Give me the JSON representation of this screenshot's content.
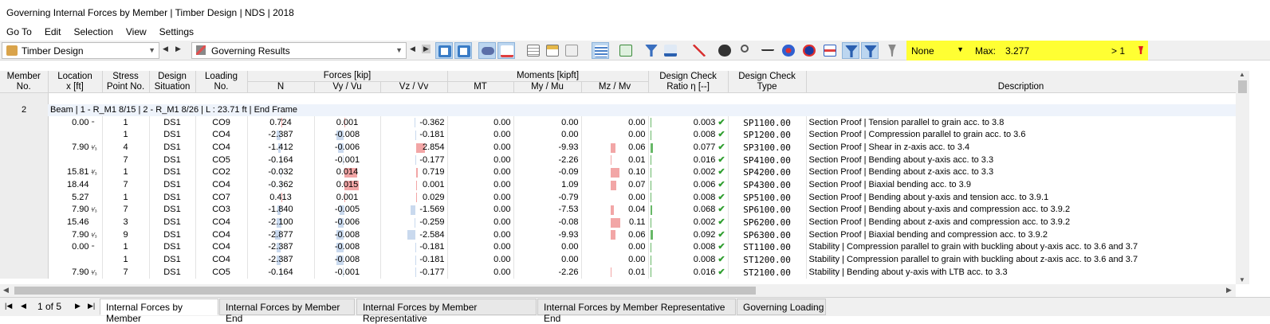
{
  "window": {
    "title": "Governing Internal Forces by Member | Timber Design | NDS | 2018"
  },
  "menu": [
    "Go To",
    "Edit",
    "Selection",
    "View",
    "Settings"
  ],
  "toolbar": {
    "module": "Timber Design",
    "results": "Governing Results",
    "filter": "None",
    "max_label": "Max:",
    "max_value": "3.277",
    "max_cond": "> 1"
  },
  "table": {
    "headers": {
      "member": [
        "Member",
        "No."
      ],
      "location": [
        "Location",
        "x [ft]"
      ],
      "stress": [
        "Stress",
        "Point No."
      ],
      "design": [
        "Design",
        "Situation"
      ],
      "loading": [
        "Loading",
        "No."
      ],
      "forces": "Forces [kip]",
      "moments": "Moments [kipft]",
      "n": "N",
      "vy": "Vy / Vu",
      "vz": "Vz / Vv",
      "mt": "MT",
      "my": "My / Mu",
      "mz": "Mz / Mv",
      "ratio": [
        "Design Check",
        "Ratio η [--]"
      ],
      "type": [
        "Design Check",
        "Type"
      ],
      "desc": "Description"
    },
    "member_no": "2",
    "group_label": "Beam | 1 - R_M1 8/15 | 2 - R_M1 8/26 | L : 23.71 ft | End Frame",
    "rows": [
      {
        "loc": "0.00",
        "locmark": "⁼",
        "sp": "1",
        "ds": "DS1",
        "lc": "CO9",
        "n": "0.724",
        "vy": "0.001",
        "vz": "-0.362",
        "mt": "0.00",
        "my": "0.00",
        "mz": "0.00",
        "ratio": "0.003",
        "type": "SP1100.00",
        "desc": "Section Proof | Tension parallel to grain acc. to 3.8"
      },
      {
        "loc": "",
        "locmark": "",
        "sp": "1",
        "ds": "DS1",
        "lc": "CO4",
        "n": "-2.387",
        "vy": "-0.008",
        "vz": "-0.181",
        "mt": "0.00",
        "my": "0.00",
        "mz": "0.00",
        "ratio": "0.008",
        "type": "SP1200.00",
        "desc": "Section Proof | Compression parallel to grain acc. to 3.6"
      },
      {
        "loc": "7.90",
        "locmark": "¹⁄₃",
        "sp": "4",
        "ds": "DS1",
        "lc": "CO4",
        "n": "-1.412",
        "vy": "-0.006",
        "vz": "2.854",
        "mt": "0.00",
        "my": "-9.93",
        "mz": "0.06",
        "ratio": "0.077",
        "type": "SP3100.00",
        "desc": "Section Proof | Shear in z-axis acc. to 3.4"
      },
      {
        "loc": "",
        "locmark": "",
        "sp": "7",
        "ds": "DS1",
        "lc": "CO5",
        "n": "-0.164",
        "vy": "-0.001",
        "vz": "-0.177",
        "mt": "0.00",
        "my": "-2.26",
        "mz": "0.01",
        "ratio": "0.016",
        "type": "SP4100.00",
        "desc": "Section Proof | Bending about y-axis acc. to 3.3"
      },
      {
        "loc": "15.81",
        "locmark": "²⁄₃",
        "sp": "1",
        "ds": "DS1",
        "lc": "CO2",
        "n": "-0.032",
        "vy": "0.014",
        "vz": "0.719",
        "mt": "0.00",
        "my": "-0.09",
        "mz": "0.10",
        "ratio": "0.002",
        "type": "SP4200.00",
        "desc": "Section Proof | Bending about z-axis acc. to 3.3"
      },
      {
        "loc": "18.44",
        "locmark": "",
        "sp": "7",
        "ds": "DS1",
        "lc": "CO4",
        "n": "-0.362",
        "vy": "0.015",
        "vz": "0.001",
        "mt": "0.00",
        "my": "1.09",
        "mz": "0.07",
        "ratio": "0.006",
        "type": "SP4300.00",
        "desc": "Section Proof | Biaxial bending acc. to 3.9"
      },
      {
        "loc": "5.27",
        "locmark": "",
        "sp": "1",
        "ds": "DS1",
        "lc": "CO7",
        "n": "0.413",
        "vy": "0.001",
        "vz": "0.029",
        "mt": "0.00",
        "my": "-0.79",
        "mz": "0.00",
        "ratio": "0.008",
        "type": "SP5100.00",
        "desc": "Section Proof | Bending about y-axis and tension acc. to 3.9.1"
      },
      {
        "loc": "7.90",
        "locmark": "¹⁄₃",
        "sp": "7",
        "ds": "DS1",
        "lc": "CO3",
        "n": "-1.840",
        "vy": "-0.005",
        "vz": "-1.569",
        "mt": "0.00",
        "my": "-7.53",
        "mz": "0.04",
        "ratio": "0.068",
        "type": "SP6100.00",
        "desc": "Section Proof | Bending about y-axis and compression acc. to 3.9.2"
      },
      {
        "loc": "15.46",
        "locmark": "",
        "sp": "3",
        "ds": "DS1",
        "lc": "CO4",
        "n": "-2.100",
        "vy": "-0.006",
        "vz": "-0.259",
        "mt": "0.00",
        "my": "-0.08",
        "mz": "0.11",
        "ratio": "0.002",
        "type": "SP6200.00",
        "desc": "Section Proof | Bending about z-axis and compression acc. to 3.9.2"
      },
      {
        "loc": "7.90",
        "locmark": "¹⁄₃",
        "sp": "9",
        "ds": "DS1",
        "lc": "CO4",
        "n": "-2.877",
        "vy": "-0.008",
        "vz": "-2.584",
        "mt": "0.00",
        "my": "-9.93",
        "mz": "0.06",
        "ratio": "0.092",
        "type": "SP6300.00",
        "desc": "Section Proof | Biaxial bending and compression acc. to 3.9.2"
      },
      {
        "loc": "0.00",
        "locmark": "⁼",
        "sp": "1",
        "ds": "DS1",
        "lc": "CO4",
        "n": "-2.387",
        "vy": "-0.008",
        "vz": "-0.181",
        "mt": "0.00",
        "my": "0.00",
        "mz": "0.00",
        "ratio": "0.008",
        "type": "ST1100.00",
        "desc": "Stability | Compression parallel to grain with buckling about y-axis acc. to 3.6 and 3.7"
      },
      {
        "loc": "",
        "locmark": "",
        "sp": "1",
        "ds": "DS1",
        "lc": "CO4",
        "n": "-2.387",
        "vy": "-0.008",
        "vz": "-0.181",
        "mt": "0.00",
        "my": "0.00",
        "mz": "0.00",
        "ratio": "0.008",
        "type": "ST1200.00",
        "desc": "Stability | Compression parallel to grain with buckling about z-axis acc. to 3.6 and 3.7"
      },
      {
        "loc": "7.90",
        "locmark": "¹⁄₃",
        "sp": "7",
        "ds": "DS1",
        "lc": "CO5",
        "n": "-0.164",
        "vy": "-0.001",
        "vz": "-0.177",
        "mt": "0.00",
        "my": "-2.26",
        "mz": "0.01",
        "ratio": "0.016",
        "type": "ST2100.00",
        "desc": "Stability | Bending about y-axis with LTB acc. to 3.3"
      }
    ]
  },
  "pager": {
    "text": "1 of 5"
  },
  "tabs": [
    "Internal Forces by Member",
    "Internal Forces by Member End",
    "Internal Forces by Member Representative",
    "Internal Forces by Member Representative End",
    "Governing Loading"
  ],
  "colors": {
    "highlight": "#ffff33",
    "positive_bar": "#f2a6a6",
    "negative_bar": "#c9d9ee",
    "check_ok": "#2e9e2e"
  }
}
